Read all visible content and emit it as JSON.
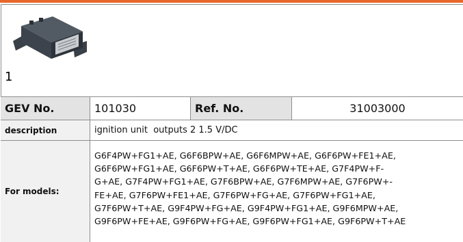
{
  "item": {
    "number": "1"
  },
  "gev": {
    "label": "GEV No.",
    "value": "101030"
  },
  "ref": {
    "label": "Ref. No.",
    "value": "31003000"
  },
  "description": {
    "label": "description",
    "value": "ignition unit  outputs 2 1.5 V/DC"
  },
  "models": {
    "label": "For models:",
    "lines": [
      "G6F4PW+FG1+AE, G6F6BPW+AE, G6F6MPW+AE, G6F6PW+FE1+AE,",
      "G6F6PW+FG1+AE, G6F6PW+T+AE, G6F6PW+TE+AE, G7F4PW+F-",
      "G+AE, G7F4PW+FG1+AE, G7F6BPW+AE, G7F6MPW+AE, G7F6PW+-",
      "FE+AE, G7F6PW+FE1+AE, G7F6PW+FG+AE, G7F6PW+FG1+AE,",
      "G7F6PW+T+AE, G9F4PW+FG+AE, G9F4PW+FG1+AE, G9F6MPW+AE,",
      "G9F6PW+FE+AE, G9F6PW+FG+AE, G9F6PW+FG1+AE, G9F6PW+T+AE"
    ]
  },
  "colors": {
    "accent": "#e8672a",
    "header_bg": "#e3e3e3",
    "label_bg": "#f1f1f1",
    "border": "#8d8d8d"
  }
}
